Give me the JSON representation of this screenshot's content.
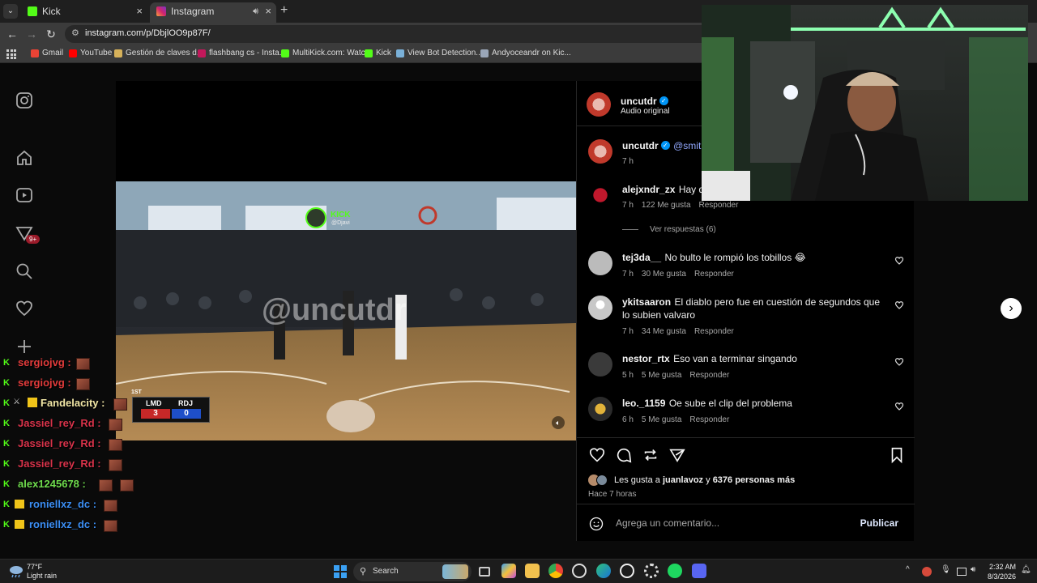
{
  "browser": {
    "tabs": [
      {
        "label": "Kick"
      },
      {
        "label": "Instagram"
      }
    ],
    "url": "instagram.com/p/DbjlOO9p87F/",
    "bookmarks": [
      {
        "label": "Gmail"
      },
      {
        "label": "YouTube"
      },
      {
        "label": "Gestión de claves d..."
      },
      {
        "label": "flashbang cs - Insta..."
      },
      {
        "label": "MultiKick.com: Watc..."
      },
      {
        "label": "Kick"
      },
      {
        "label": "View Bot Detection..."
      },
      {
        "label": "Andyoceandr on Kic..."
      }
    ]
  },
  "sidebar": {
    "notifications_badge": "9+"
  },
  "video": {
    "overlay_brand": "KICK",
    "overlay_handle": "@Djavi",
    "watermark": "@uncutdr",
    "scoreboard": {
      "period": "1ST",
      "team_left": "LMD",
      "team_right": "RDJ",
      "score_left": "3",
      "score_right": "0"
    }
  },
  "post": {
    "author": "uncutdr",
    "audio": "Audio original",
    "caption_user": "uncutdr",
    "caption_mention": "@smithj",
    "caption_time": "7 h",
    "comments": [
      {
        "user": "alejxndr_zx",
        "text": "Hay q a",
        "time": "7 h",
        "likes": "122 Me gusta",
        "reply": "Responder"
      },
      {
        "user": "tej3da__",
        "text": "No bulto le rompió los tobillos 😂",
        "time": "7 h",
        "likes": "30 Me gusta",
        "reply": "Responder"
      },
      {
        "user": "ykitsaaron",
        "text": "El diablo pero fue en cuestión de segundos que lo subien valvaro",
        "time": "7 h",
        "likes": "34 Me gusta",
        "reply": "Responder"
      },
      {
        "user": "nestor_rtx",
        "text": "Eso van a terminar singando",
        "time": "5 h",
        "likes": "5 Me gusta",
        "reply": "Responder"
      },
      {
        "user": "leo._1159",
        "text": "Oe sube el clip del problema",
        "time": "6 h",
        "likes": "5 Me gusta",
        "reply": "Responder"
      }
    ],
    "view_replies": "Ver respuestas (6)",
    "likes_prefix": "Les gusta a ",
    "likes_user": "juanlavoz",
    "likes_mid": " y ",
    "likes_rest": "6376 personas más",
    "posted": "Hace 7 horas",
    "comment_placeholder": "Agrega un comentario...",
    "publish": "Publicar"
  },
  "chat": [
    {
      "user": "sergiojvg :",
      "color": "#e23b3b"
    },
    {
      "user": "sergiojvg :",
      "color": "#e23b3b"
    },
    {
      "user": "Fandelacity :",
      "color": "#f2e7a6"
    },
    {
      "user": "Jassiel_rey_Rd :",
      "color": "#d8334a"
    },
    {
      "user": "Jassiel_rey_Rd :",
      "color": "#d8334a"
    },
    {
      "user": "Jassiel_rey_Rd :",
      "color": "#d8334a"
    },
    {
      "user": "alex1245678 :",
      "color": "#6fdc4d"
    },
    {
      "user": "roniellxz_dc :",
      "color": "#3b8df2"
    },
    {
      "user": "roniellxz_dc :",
      "color": "#3b8df2"
    }
  ],
  "taskbar": {
    "weather_temp": "77°F",
    "weather_desc": "Light rain",
    "search": "Search",
    "time": "2:32 AM",
    "date": "8/3/2026"
  }
}
